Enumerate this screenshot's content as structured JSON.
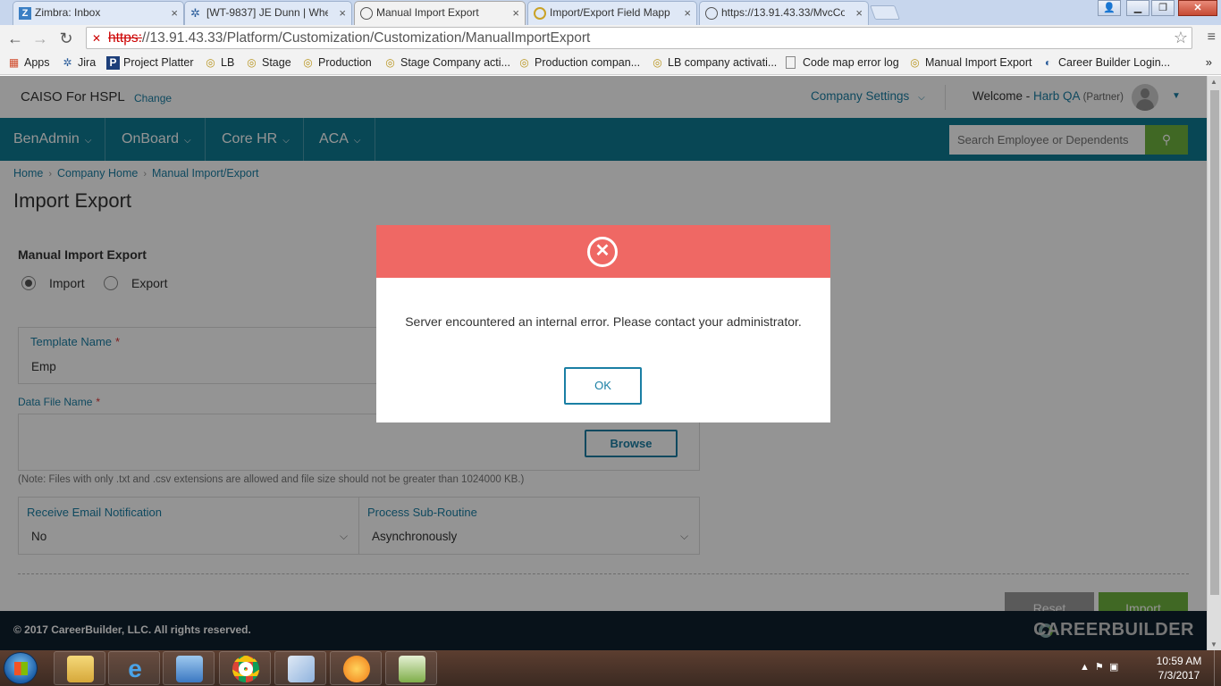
{
  "browser": {
    "tabs": [
      {
        "title": "Zimbra: Inbox",
        "icon": "zimbra-icon"
      },
      {
        "title": "[WT-9837] JE Dunn | When",
        "icon": "jira-icon"
      },
      {
        "title": "Manual Import Export",
        "icon": "page-icon"
      },
      {
        "title": "Import/Export Field Mapp",
        "icon": "globe-icon"
      },
      {
        "title": "https://13.91.43.33/MvcCo",
        "icon": "page-icon"
      }
    ],
    "active_tab": 2,
    "url_scheme": "https:",
    "url_rest": "//13.91.43.33/Platform/Customization/Customization/ManualImportExport",
    "bookmarks": [
      {
        "label": "Apps",
        "icon": "apps-grid-icon"
      },
      {
        "label": "Jira",
        "icon": "jira-icon"
      },
      {
        "label": "Project Platter",
        "icon": "p-icon"
      },
      {
        "label": "LB",
        "icon": "globe-icon"
      },
      {
        "label": "Stage",
        "icon": "globe-icon"
      },
      {
        "label": "Production",
        "icon": "globe-icon"
      },
      {
        "label": "Stage Company acti...",
        "icon": "globe-icon"
      },
      {
        "label": "Production compan...",
        "icon": "globe-icon"
      },
      {
        "label": "LB company activati...",
        "icon": "globe-icon"
      },
      {
        "label": "Code map error log",
        "icon": "page-icon"
      },
      {
        "label": "Manual Import Export",
        "icon": "globe-icon"
      },
      {
        "label": "Career Builder Login...",
        "icon": "page-icon"
      }
    ],
    "bookmarks_more": "»"
  },
  "header": {
    "company": "CAISO For HSPL",
    "change": "Change",
    "company_settings": "Company Settings",
    "welcome": "Welcome - ",
    "user": "Harb QA",
    "role": "(Partner)"
  },
  "nav": {
    "items": [
      "BenAdmin",
      "OnBoard",
      "Core HR",
      "ACA"
    ],
    "search_placeholder": "Search Employee or Dependents"
  },
  "breadcrumb": [
    "Home",
    "Company Home",
    "Manual Import/Export"
  ],
  "page_title": "Import Export",
  "form": {
    "section_title": "Manual Import Export",
    "radio_import": "Import",
    "radio_export": "Export",
    "selected_mode": "Import",
    "template_label": "Template Name",
    "template_value": "Emp",
    "data_file_label": "Data File Name",
    "browse": "Browse",
    "note": "(Note: Files with only .txt and .csv extensions are allowed and file size should not be greater than 1024000 KB.)",
    "email_label": "Receive Email Notification",
    "email_value": "No",
    "subroutine_label": "Process Sub-Routine",
    "subroutine_value": "Asynchronously",
    "reset": "Reset",
    "import": "Import",
    "required_mark": "*"
  },
  "footer": {
    "copyright": "© 2017 CareerBuilder, LLC. All rights reserved.",
    "brand": "CAREERBUILDER"
  },
  "modal": {
    "message": "Server encountered an internal error. Please contact your administrator.",
    "ok": "OK",
    "header_color": "#ef6864",
    "icon": "error-x-circle-icon"
  },
  "taskbar": {
    "time": "10:59 AM",
    "date": "7/3/2017"
  },
  "colors": {
    "nav": "#0e7a93",
    "link": "#1a7fa4",
    "accent_green": "#6fb43f",
    "footer": "#0f1f2e"
  }
}
